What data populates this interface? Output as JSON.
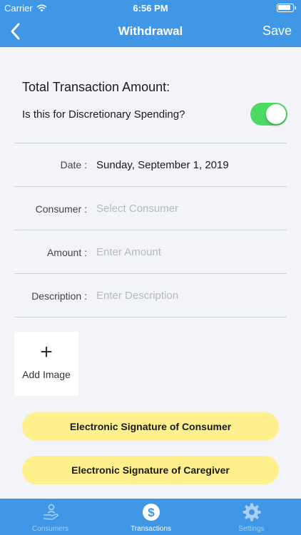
{
  "status_bar": {
    "carrier": "Carrier",
    "time": "6:56 PM"
  },
  "nav": {
    "title": "Withdrawal",
    "save_label": "Save",
    "back_icon": "chevron-left-icon"
  },
  "form": {
    "total_label": "Total Transaction Amount:",
    "discretionary_label": "Is this for Discretionary Spending?",
    "discretionary_on": true,
    "rows": [
      {
        "label": "Date :",
        "value": "Sunday, September 1, 2019",
        "placeholder": ""
      },
      {
        "label": "Consumer :",
        "value": "",
        "placeholder": "Select Consumer"
      },
      {
        "label": "Amount :",
        "value": "",
        "placeholder": "Enter Amount"
      },
      {
        "label": "Description :",
        "value": "",
        "placeholder": "Enter Description"
      }
    ],
    "add_image": {
      "plus": "+",
      "label": "Add Image"
    },
    "signature_consumer": "Electronic Signature of Consumer",
    "signature_caregiver": "Electronic Signature of Caregiver"
  },
  "tabs": [
    {
      "label": "Consumers",
      "icon": "hand-person-icon",
      "active": false
    },
    {
      "label": "Transactions",
      "icon": "dollar-icon",
      "active": true
    },
    {
      "label": "Settings",
      "icon": "gear-icon",
      "active": false
    }
  ],
  "colors": {
    "brand": "#3f97e6",
    "toggle_on": "#4cd964",
    "signature_button": "#fff08e",
    "background": "#f2f4f8"
  }
}
